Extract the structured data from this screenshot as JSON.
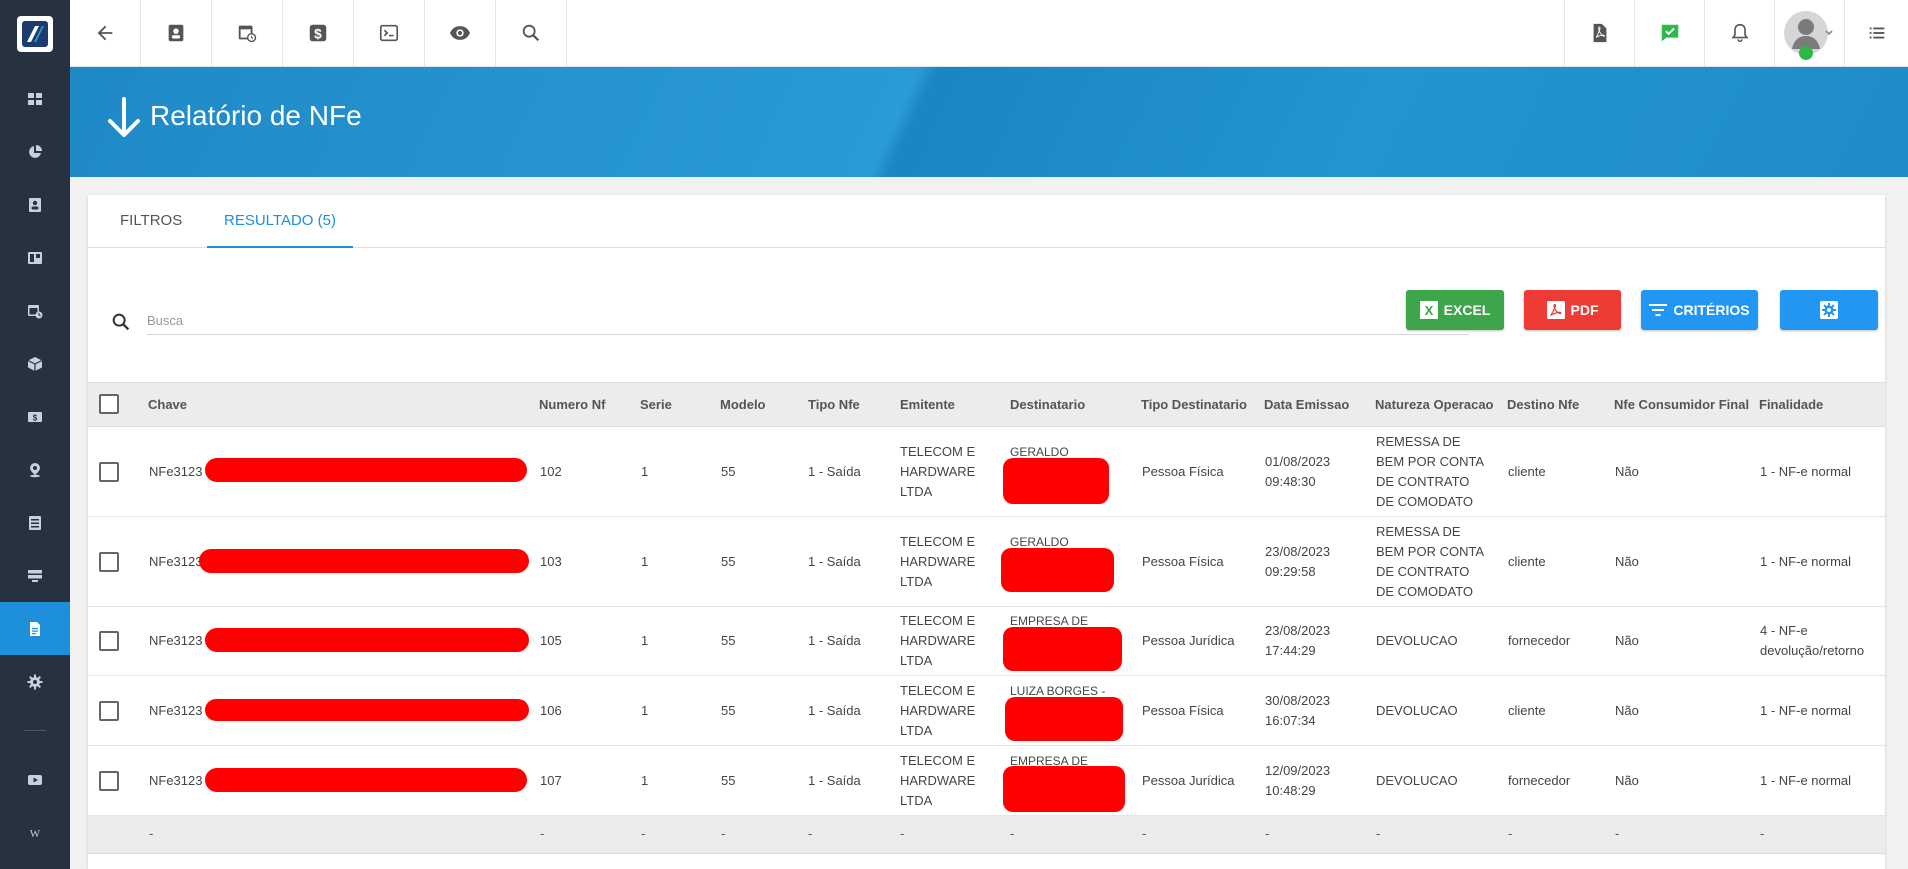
{
  "sidebar": {
    "icons": [
      "dashboard-icon",
      "pie-chart-icon",
      "contact-card-icon",
      "board-icon",
      "calendar-clock-icon",
      "box-icon",
      "money-icon",
      "map-pin-icon",
      "list-icon",
      "server-icon",
      "document-icon",
      "gear-icon",
      "video-icon",
      "wiki-icon"
    ],
    "active": "document-icon"
  },
  "topbar": {
    "left_icons": [
      "back-arrow-icon",
      "contact-card-icon",
      "calendar-clock-icon",
      "dollar-icon",
      "terminal-icon",
      "eye-icon",
      "search-icon"
    ],
    "right_icons": [
      "pdf-file-icon",
      "chat-check-icon",
      "bell-icon",
      "avatar",
      "menu-list-icon"
    ]
  },
  "banner": {
    "title": "Relatório de NFe"
  },
  "tabs": [
    {
      "label": "FILTROS",
      "active": false
    },
    {
      "label": "RESULTADO (5)",
      "active": true
    }
  ],
  "search": {
    "placeholder": "Busca",
    "value": ""
  },
  "buttons": {
    "excel": "EXCEL",
    "pdf": "PDF",
    "criterios": "CRITÉRIOS"
  },
  "table": {
    "columns": [
      "Chave",
      "Numero Nf",
      "Serie",
      "Modelo",
      "Tipo Nfe",
      "Emitente",
      "Destinatario",
      "Tipo Destinatario",
      "Data Emissao",
      "Natureza Operacao",
      "Destino Nfe",
      "Nfe Consumidor Final",
      "Finalidade"
    ],
    "rows": [
      {
        "chave": "NFe3123",
        "numero": "102",
        "serie": "1",
        "modelo": "55",
        "tipo": "1 - Saída",
        "emitente": "TELECOM E HARDWARE LTDA",
        "destinatario": "GERALDO",
        "tipo_dest": "Pessoa Física",
        "data": "01/08/2023",
        "hora": "09:48:30",
        "natureza": "REMESSA DE BEM POR CONTA DE CONTRATO DE COMODATO",
        "destino": "cliente",
        "consumidor": "Não",
        "finalidade": "1 - NF-e normal"
      },
      {
        "chave": "NFe3123",
        "numero": "103",
        "serie": "1",
        "modelo": "55",
        "tipo": "1 - Saída",
        "emitente": "TELECOM E HARDWARE LTDA",
        "destinatario": "GERALDO",
        "tipo_dest": "Pessoa Física",
        "data": "23/08/2023",
        "hora": "09:29:58",
        "natureza": "REMESSA DE BEM POR CONTA DE CONTRATO DE COMODATO",
        "destino": "cliente",
        "consumidor": "Não",
        "finalidade": "1 - NF-e normal"
      },
      {
        "chave": "NFe3123",
        "numero": "105",
        "serie": "1",
        "modelo": "55",
        "tipo": "1 - Saída",
        "emitente": "TELECOM E HARDWARE LTDA",
        "destinatario": "EMPRESA DE",
        "tipo_dest": "Pessoa Jurídica",
        "data": "23/08/2023",
        "hora": "17:44:29",
        "natureza": "DEVOLUCAO",
        "destino": "fornecedor",
        "consumidor": "Não",
        "finalidade": "4 - NF-e devolução/retorno"
      },
      {
        "chave": "NFe3123",
        "numero": "106",
        "serie": "1",
        "modelo": "55",
        "tipo": "1 - Saída",
        "emitente": "TELECOM E HARDWARE LTDA",
        "destinatario": "LUIZA BORGES -",
        "tipo_dest": "Pessoa Física",
        "data": "30/08/2023",
        "hora": "16:07:34",
        "natureza": "DEVOLUCAO",
        "destino": "cliente",
        "consumidor": "Não",
        "finalidade": "1 - NF-e normal"
      },
      {
        "chave": "NFe3123",
        "numero": "107",
        "serie": "1",
        "modelo": "55",
        "tipo": "1 - Saída",
        "emitente": "TELECOM E HARDWARE LTDA",
        "destinatario": "EMPRESA DE",
        "tipo_dest": "Pessoa Jurídica",
        "data": "12/09/2023",
        "hora": "10:48:29",
        "natureza": "DEVOLUCAO",
        "destino": "fornecedor",
        "consumidor": "Não",
        "finalidade": "1 - NF-e normal"
      }
    ],
    "footer_placeholder": "-"
  }
}
